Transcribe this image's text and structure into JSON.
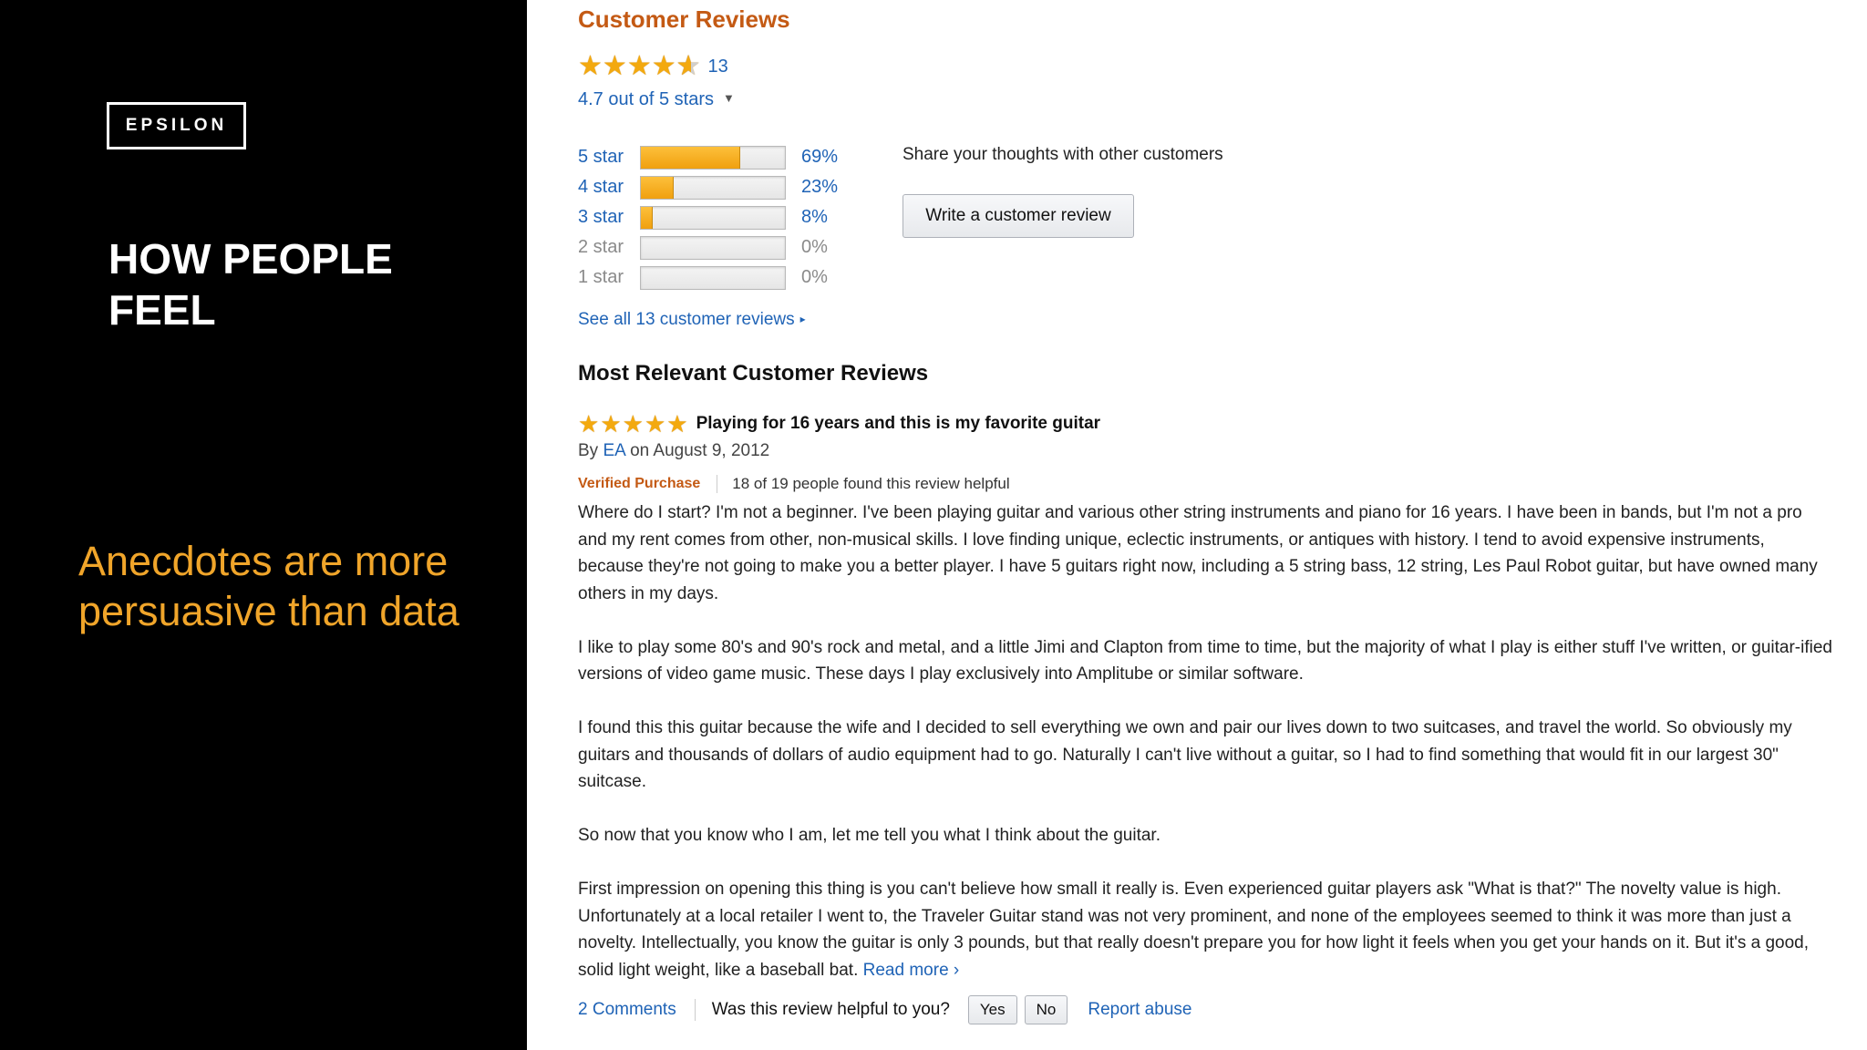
{
  "slide": {
    "logo": "EPSILON",
    "headline": "HOW PEOPLE FEEL",
    "tagline": "Anecdotes are more persuasive than data",
    "tagline_color": "#f0a52a"
  },
  "reviews": {
    "title": "Customer Reviews",
    "rating_count": "13",
    "rating_value": 4.7,
    "rating_text": "4.7 out of 5 stars",
    "histogram": [
      {
        "label": "5 star",
        "percent_text": "69%",
        "fraction": 0.69
      },
      {
        "label": "4 star",
        "percent_text": "23%",
        "fraction": 0.23
      },
      {
        "label": "3 star",
        "percent_text": "8%",
        "fraction": 0.08
      },
      {
        "label": "2 star",
        "percent_text": "0%",
        "fraction": 0
      },
      {
        "label": "1 star",
        "percent_text": "0%",
        "fraction": 0
      }
    ],
    "share_text": "Share your thoughts with other customers",
    "write_review_label": "Write a customer review",
    "see_all": "See all 13 customer reviews"
  },
  "most_relevant": {
    "title": "Most Relevant Customer Reviews",
    "review": {
      "stars": 5,
      "title": "Playing for 16 years and this is my favorite guitar",
      "by_prefix": "By",
      "author": "EA",
      "date": "on August 9, 2012",
      "verified": "Verified Purchase",
      "helpful_count": "18 of 19 people found this review helpful",
      "paragraphs": [
        "Where do I start? I'm not a beginner. I've been playing guitar and various other string instruments and piano for 16 years. I have been in bands, but I'm not a pro and my rent comes from other, non-musical skills. I love finding unique, eclectic instruments, or antiques with history. I tend to avoid expensive instruments, because they're not going to make you a better player. I have 5 guitars right now, including a 5 string bass, 12 string, Les Paul Robot guitar, but have owned many others in my days.",
        "I like to play some 80's and 90's rock and metal, and a little Jimi and Clapton from time to time, but the majority of what I play is either stuff I've written, or guitar-ified versions of video game music. These days I play exclusively into Amplitube or similar software.",
        "I found this this guitar because the wife and I decided to sell everything we own and pair our lives down to two suitcases, and travel the world. So obviously my guitars and thousands of dollars of audio equipment had to go. Naturally I can't live without a guitar, so I had to find something that would fit in our largest 30\" suitcase.",
        "So now that you know who I am, let me tell you what I think about the guitar.",
        "First impression on opening this thing is you can't believe how small it really is. Even experienced guitar players ask \"What is that?\" The novelty value is high. Unfortunately at a local retailer I went to, the Traveler Guitar stand was not very prominent, and none of the employees seemed to think it was more than just a novelty. Intellectually, you know the guitar is only 3 pounds, but that really doesn't prepare you for how light it feels when you get your hands on it. But it's a good, solid light weight, like a baseball bat."
      ],
      "read_more": "Read more ›",
      "comments": "2 Comments",
      "helpful_question": "Was this review helpful to you?",
      "yes": "Yes",
      "no": "No",
      "report": "Report abuse"
    }
  }
}
